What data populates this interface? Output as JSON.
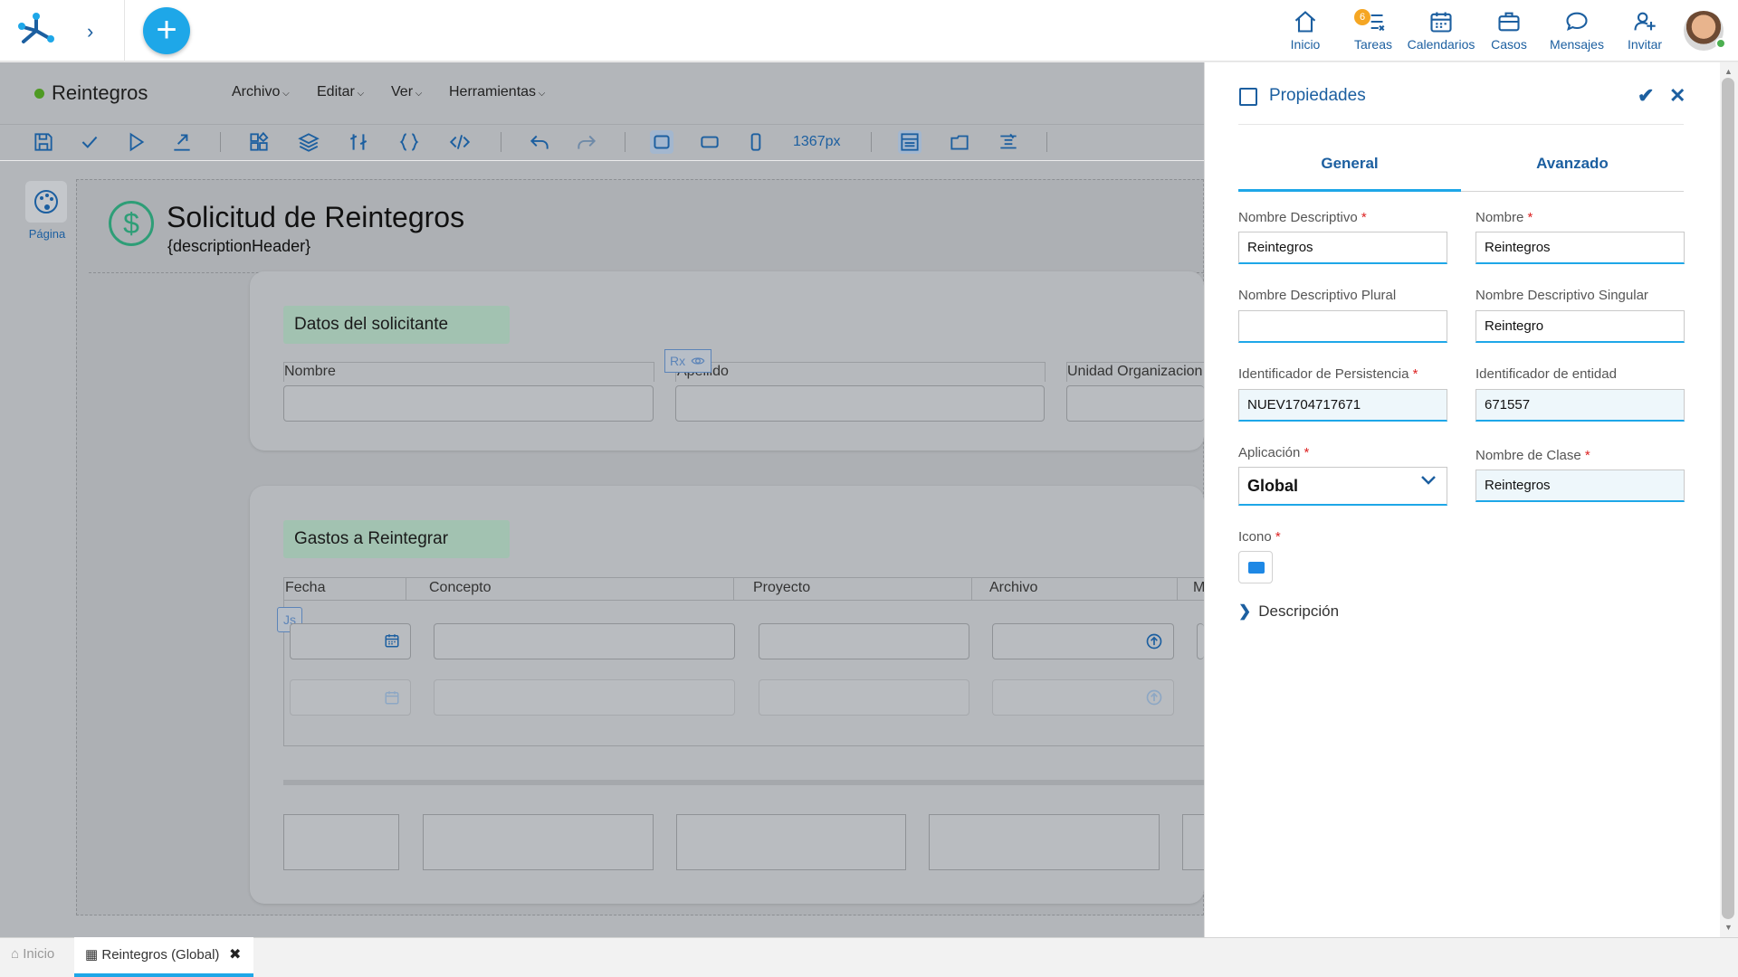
{
  "nav": {
    "items": [
      {
        "label": "Inicio",
        "icon": "home-icon"
      },
      {
        "label": "Tareas",
        "icon": "tasks-icon",
        "badge": "6"
      },
      {
        "label": "Calendarios",
        "icon": "calendar-icon"
      },
      {
        "label": "Casos",
        "icon": "briefcase-icon"
      },
      {
        "label": "Mensajes",
        "icon": "chat-icon"
      },
      {
        "label": "Invitar",
        "icon": "invite-user-icon"
      }
    ],
    "add_symbol": "+",
    "expand_symbol": "›"
  },
  "editor": {
    "form_name": "Reintegros",
    "menus": [
      "Archivo",
      "Editar",
      "Ver",
      "Herramientas"
    ],
    "width_label": "1367px",
    "page_tool_label": "Página"
  },
  "form": {
    "title": "Solicitud de Reintegros",
    "subtitle": "{descriptionHeader}",
    "section1": {
      "title": "Datos del solicitante",
      "fields": [
        "Nombre",
        "Apellido",
        "Unidad Organizacion"
      ],
      "rx_tag": "Rx"
    },
    "section2": {
      "title": "Gastos a Reintegrar",
      "columns": [
        "Fecha",
        "Concepto",
        "Proyecto",
        "Archivo",
        "M"
      ],
      "js_tag": "Js"
    }
  },
  "properties": {
    "title": "Propiedades",
    "tabs": [
      "General",
      "Avanzado"
    ],
    "active_tab": "General",
    "fields": {
      "nombre_descriptivo": {
        "label": "Nombre Descriptivo",
        "value": "Reintegros",
        "required": true
      },
      "nombre": {
        "label": "Nombre",
        "value": "Reintegros",
        "required": true
      },
      "plural": {
        "label": "Nombre Descriptivo Plural",
        "value": ""
      },
      "singular": {
        "label": "Nombre Descriptivo Singular",
        "value": "Reintegro"
      },
      "persistencia": {
        "label": "Identificador de Persistencia",
        "value": "NUEV1704717671",
        "required": true
      },
      "entidad": {
        "label": "Identificador de entidad",
        "value": "671557"
      },
      "aplicacion": {
        "label": "Aplicación",
        "value": "Global",
        "required": true
      },
      "clase": {
        "label": "Nombre de Clase",
        "value": "Reintegros",
        "required": true
      },
      "icono": {
        "label": "Icono",
        "required": true
      }
    },
    "required_mark": "*",
    "descripcion_label": "Descripción"
  },
  "bottom_tabs": [
    {
      "label": "Inicio"
    },
    {
      "label": "Reintegros (Global)",
      "active": true
    }
  ],
  "colors": {
    "accent": "#1ea7e8",
    "primary": "#1c5fa0",
    "section": "#a2c2b1",
    "success": "#2e9e77"
  }
}
